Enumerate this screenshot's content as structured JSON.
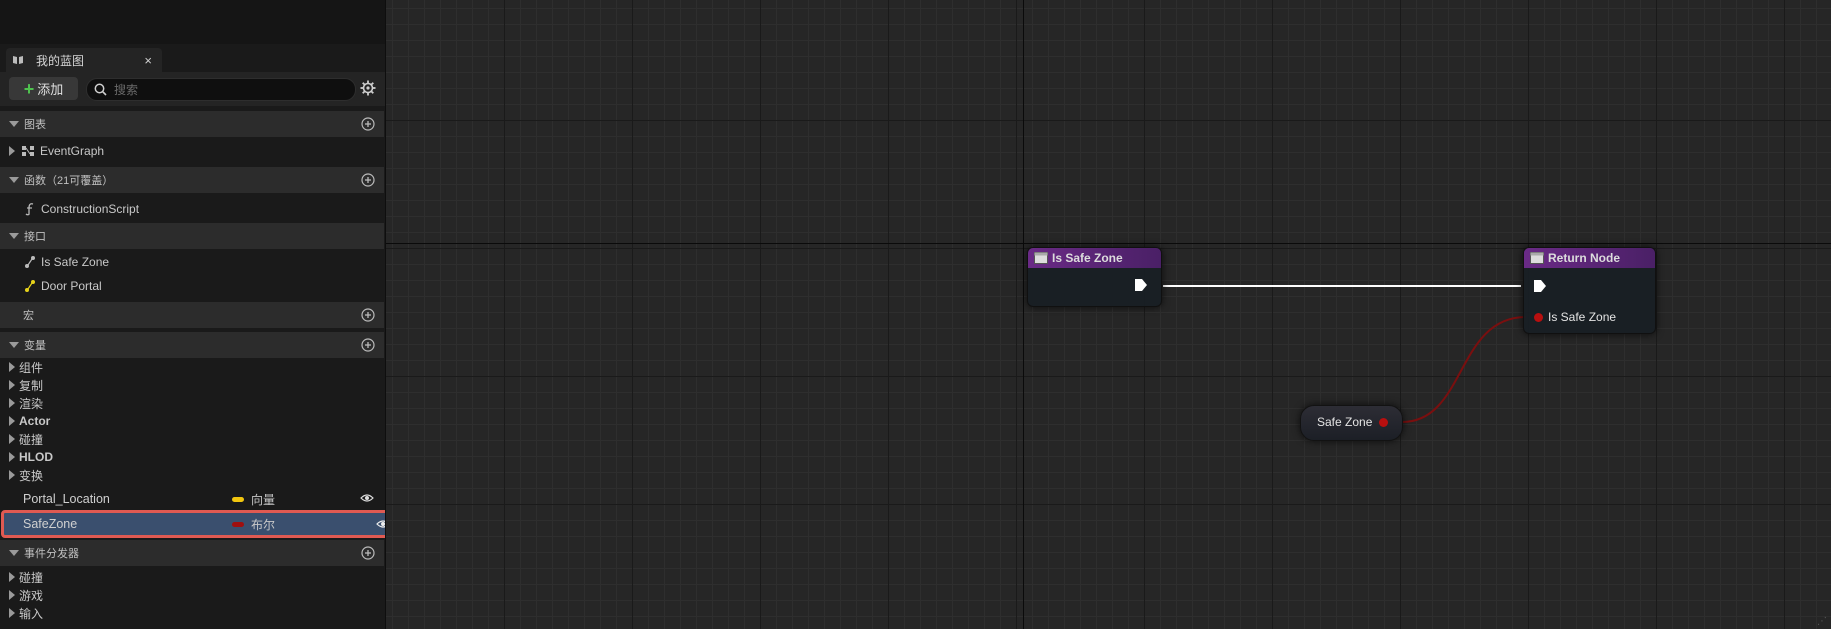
{
  "panel": {
    "tab_title": "我的蓝图",
    "tab_close": "×",
    "add_label": "添加",
    "search_placeholder": "搜索",
    "sections": {
      "graphs": "图表",
      "functions": "函数（21可覆盖）",
      "interfaces": "接口",
      "macros": "宏",
      "variables": "变量",
      "dispatchers": "事件分发器"
    },
    "graph_items": [
      "EventGraph"
    ],
    "function_items": [
      "ConstructionScript"
    ],
    "interface_items": [
      "Is Safe Zone",
      "Door Portal"
    ],
    "variable_categories": [
      "组件",
      "复制",
      "渲染",
      "Actor",
      "碰撞",
      "HLOD",
      "变换"
    ],
    "variables": [
      {
        "name": "Portal_Location",
        "type": "向量",
        "color": "#f2c60f"
      },
      {
        "name": "SafeZone",
        "type": "布尔",
        "color": "#a00f0f",
        "selected": true
      }
    ],
    "dispatcher_categories": [
      "碰撞",
      "游戏",
      "输入"
    ]
  },
  "graph": {
    "node_is_safe_zone": {
      "title": "Is Safe Zone"
    },
    "node_return": {
      "title": "Return Node",
      "pin_label": "Is Safe Zone"
    },
    "node_var": {
      "label": "Safe Zone"
    },
    "colors": {
      "exec_wire": "#ffffff",
      "bool_wire": "#7a0f0f",
      "header": "#6a2a86"
    }
  }
}
